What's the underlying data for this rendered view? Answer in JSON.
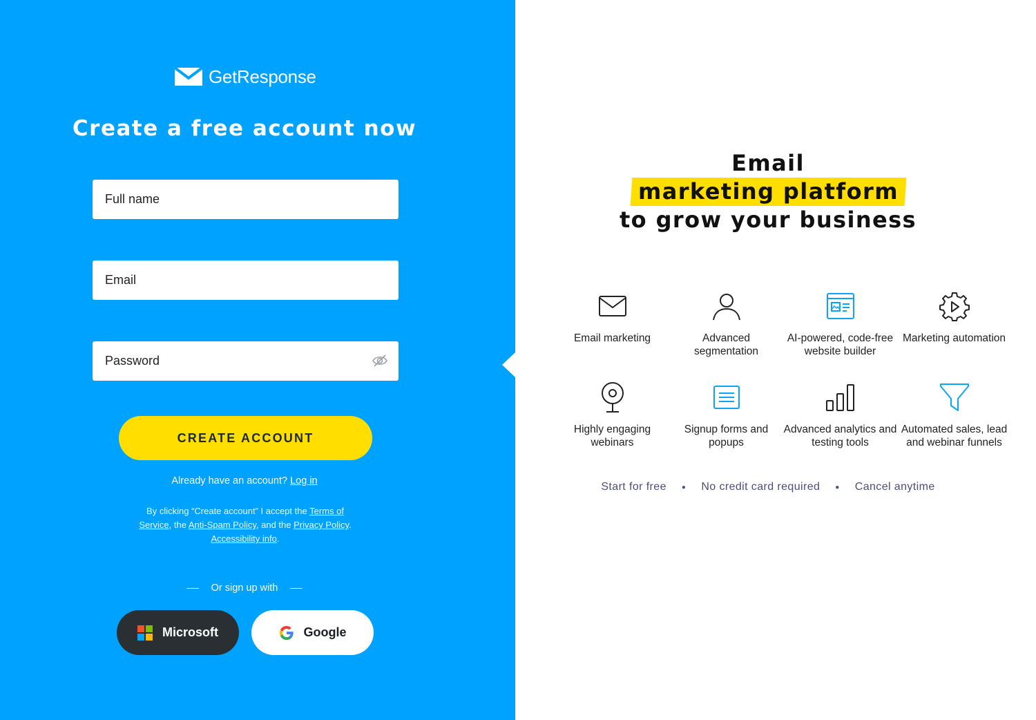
{
  "brand": {
    "name": "GetResponse"
  },
  "signup": {
    "headline": "Create a free account now",
    "fields": {
      "full_name_placeholder": "Full name",
      "email_placeholder": "Email",
      "password_placeholder": "Password"
    },
    "submit_label": "CREATE ACCOUNT",
    "have_account_text": "Already have an account? ",
    "login_link": "Log in",
    "terms": {
      "pre": "By clicking “Create account” I accept the ",
      "tos": "Terms of Service",
      "mid1": ", the ",
      "antispam": "Anti-Spam Policy",
      "mid2": ", and the ",
      "privacy": "Privacy Policy",
      "mid3": ". ",
      "accessibility": "Accessibility info",
      "end": "."
    },
    "or_sign_up": "Or sign up with",
    "social": {
      "microsoft": "Microsoft",
      "google": "Google"
    }
  },
  "promo": {
    "title_line1": "Email",
    "title_line2": "marketing platform",
    "title_line3": "to grow your business",
    "features": [
      {
        "icon": "envelope-icon",
        "label": "Email marketing"
      },
      {
        "icon": "user-icon",
        "label": "Advanced segmentation"
      },
      {
        "icon": "website-builder-icon",
        "label": "AI-powered, code-free website builder"
      },
      {
        "icon": "gear-play-icon",
        "label": "Marketing automation"
      },
      {
        "icon": "webcam-icon",
        "label": "Highly engaging webinars"
      },
      {
        "icon": "form-icon",
        "label": "Signup forms and popups"
      },
      {
        "icon": "bar-chart-icon",
        "label": "Advanced analytics and testing tools"
      },
      {
        "icon": "funnel-icon",
        "label": "Automated sales, lead and webinar funnels"
      }
    ],
    "bullets": [
      "Start for free",
      "No credit card required",
      "Cancel anytime"
    ]
  },
  "colors": {
    "left_bg": "#00a2ff",
    "cta": "#ffde00",
    "highlight": "#ffde00",
    "icon_blue": "#0aa5f5",
    "bullet_text": "#4b4f7a"
  }
}
